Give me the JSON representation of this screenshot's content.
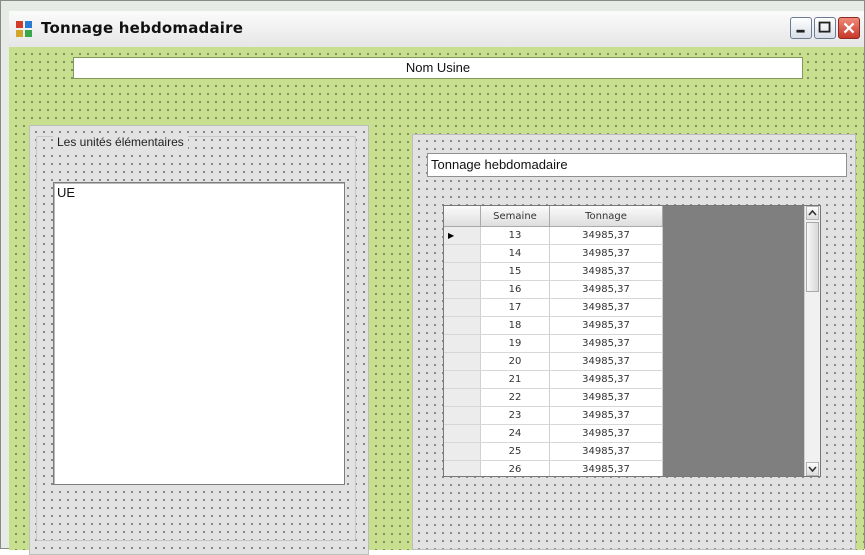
{
  "window": {
    "title": "Tonnage hebdomadaire",
    "controls": [
      "minimize",
      "maximize",
      "close"
    ]
  },
  "plant_name_field": {
    "value": "Nom Usine"
  },
  "elementary_units": {
    "group_label": "Les unités élémentaires",
    "items": [
      "UE"
    ]
  },
  "weekly_tonnage": {
    "title_field": "Tonnage hebdomadaire",
    "columns": [
      "Semaine",
      "Tonnage"
    ],
    "current_row_marker": "▶",
    "rows": [
      {
        "semaine": "13",
        "tonnage": "34985,37"
      },
      {
        "semaine": "14",
        "tonnage": "34985,37"
      },
      {
        "semaine": "15",
        "tonnage": "34985,37"
      },
      {
        "semaine": "16",
        "tonnage": "34985,37"
      },
      {
        "semaine": "17",
        "tonnage": "34985,37"
      },
      {
        "semaine": "18",
        "tonnage": "34985,37"
      },
      {
        "semaine": "19",
        "tonnage": "34985,37"
      },
      {
        "semaine": "20",
        "tonnage": "34985,37"
      },
      {
        "semaine": "21",
        "tonnage": "34985,37"
      },
      {
        "semaine": "22",
        "tonnage": "34985,37"
      },
      {
        "semaine": "23",
        "tonnage": "34985,37"
      },
      {
        "semaine": "24",
        "tonnage": "34985,37"
      },
      {
        "semaine": "25",
        "tonnage": "34985,37"
      },
      {
        "semaine": "26",
        "tonnage": "34985,37"
      }
    ]
  },
  "colors": {
    "form_background": "#c7df8e",
    "panel_background": "#e2e2e2",
    "grid_background": "#7f7f7f"
  }
}
